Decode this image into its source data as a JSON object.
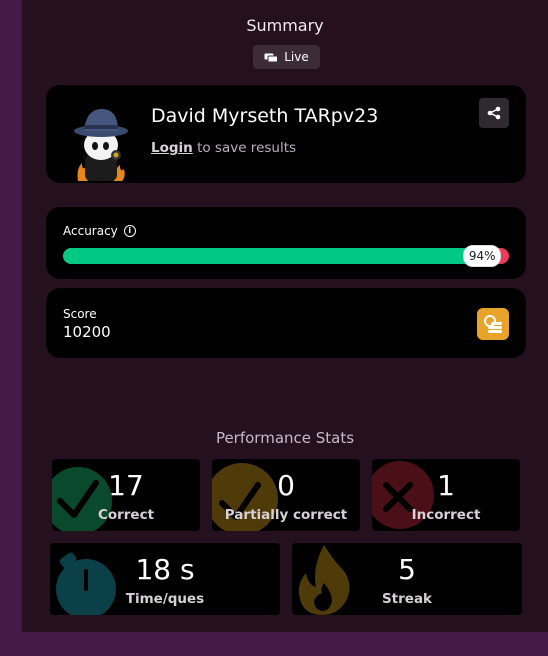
{
  "header": {
    "title": "Summary",
    "live_label": "Live"
  },
  "profile": {
    "name": "David Myrseth TARpv23",
    "login_link": "Login",
    "login_suffix": " to save results"
  },
  "accuracy": {
    "label": "Accuracy",
    "percent_text": "94%",
    "value": 0.94
  },
  "score": {
    "label": "Score",
    "value": "10200"
  },
  "performance": {
    "title": "Performance Stats",
    "correct": {
      "value": "17",
      "label": "Correct"
    },
    "partial": {
      "value": "0",
      "label": "Partially correct"
    },
    "incorrect": {
      "value": "1",
      "label": "Incorrect"
    },
    "time": {
      "value": "18 s",
      "label": "Time/ques"
    },
    "streak": {
      "value": "5",
      "label": "Streak"
    }
  },
  "colors": {
    "accuracy_fill": "#00c985",
    "accuracy_track": "#ec3a5c",
    "coin_button": "#e8a42a",
    "correct_icon": "#0a4a2c",
    "partial_icon": "#4f3a0a",
    "incorrect_icon": "#4a0f17",
    "time_icon": "#0b4048",
    "streak_icon": "#4f3a0a"
  },
  "icons": {
    "live": "live-icon",
    "share": "share-icon",
    "info": "info-icon",
    "coins": "coins-icon",
    "correct": "check-icon",
    "partial": "check-icon",
    "incorrect": "x-icon",
    "time": "stopwatch-icon",
    "streak": "flame-icon"
  }
}
